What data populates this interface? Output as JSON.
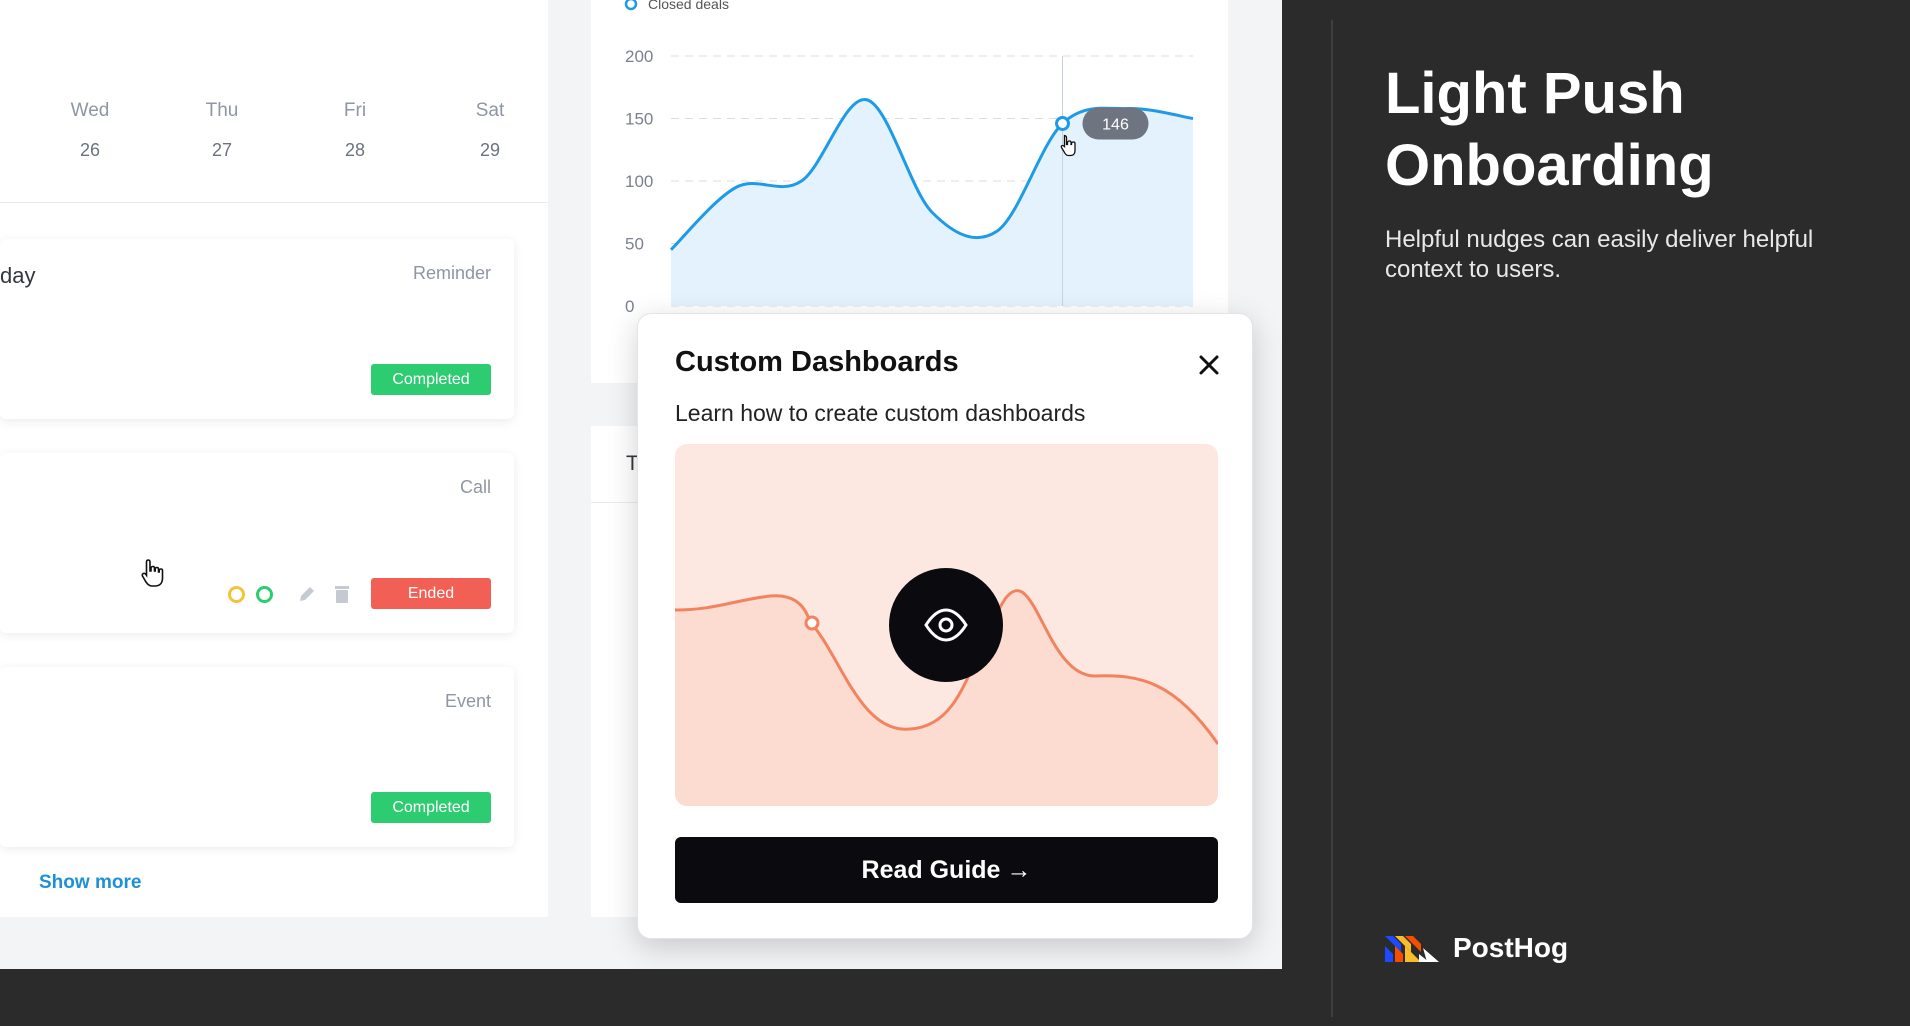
{
  "calendar": {
    "days": [
      {
        "name": "Wed",
        "num": "26"
      },
      {
        "name": "Thu",
        "num": "27"
      },
      {
        "name": "Fri",
        "num": "28"
      },
      {
        "name": "Sat",
        "num": "29"
      }
    ]
  },
  "agenda": {
    "cards": [
      {
        "title": "day",
        "type": "Reminder",
        "status": "Completed"
      },
      {
        "title": "",
        "type": "Call",
        "status": "Ended"
      },
      {
        "title": "",
        "type": "Event",
        "status": "Completed"
      }
    ],
    "show_more": "Show more"
  },
  "chart_data": {
    "type": "area",
    "legend": [
      "Closed deals"
    ],
    "yticks": [
      "200",
      "150",
      "100",
      "50",
      "0"
    ],
    "ylim": [
      0,
      200
    ],
    "x": [
      0,
      1,
      2,
      3,
      4,
      5,
      6,
      7,
      8
    ],
    "series": [
      {
        "name": "Closed deals",
        "values": [
          45,
          95,
          100,
          165,
          75,
          60,
          146,
          158,
          150
        ]
      }
    ],
    "tooltip_value": "146",
    "grid": true,
    "colors": {
      "line": "#1e9be6",
      "fill": "#e3f2fc"
    }
  },
  "second_card": {
    "title": "T"
  },
  "popup": {
    "title": "Custom Dashboards",
    "subtitle": "Learn how to create custom dashboards",
    "button_label": "Read Guide",
    "button_arrow": "→",
    "illustration_icon": "eye-icon"
  },
  "side": {
    "title": "Light Push Onboarding",
    "description": "Helpful nudges can easily deliver helpful context to users.",
    "brand": "PostHog"
  }
}
